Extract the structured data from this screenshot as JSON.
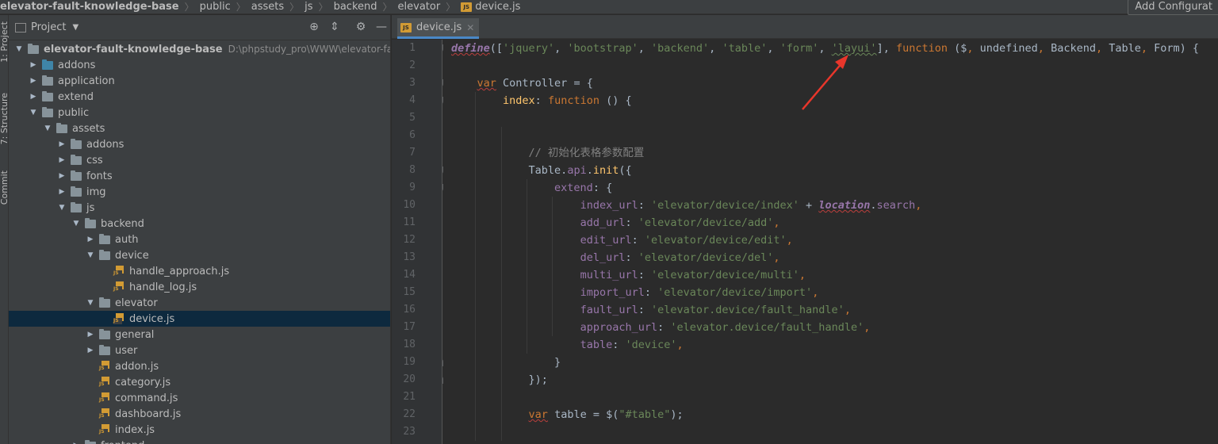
{
  "breadcrumbs": [
    "elevator-fault-knowledge-base",
    "public",
    "assets",
    "js",
    "backend",
    "elevator",
    "device.js"
  ],
  "toolbar": {
    "add_config": "Add Configurat"
  },
  "tool_windows": [
    "1: Project",
    "7: Structure",
    "Commit"
  ],
  "project_panel": {
    "title": "Project",
    "locate_icon": "crosshair-icon",
    "collapse_icon": "collapse-icon",
    "settings_icon": "gear-icon",
    "hide_icon": "minimize-icon"
  },
  "tree": [
    {
      "label": "elevator-fault-knowledge-base",
      "path": "D:\\phpstudy_pro\\WWW\\elevator-fault-knowledge-base",
      "depth": 0,
      "type": "folder",
      "expanded": true,
      "bold": true
    },
    {
      "label": "addons",
      "depth": 1,
      "type": "module",
      "expanded": false
    },
    {
      "label": "application",
      "depth": 1,
      "type": "folder",
      "expanded": false
    },
    {
      "label": "extend",
      "depth": 1,
      "type": "folder",
      "expanded": false
    },
    {
      "label": "public",
      "depth": 1,
      "type": "folder",
      "expanded": true
    },
    {
      "label": "assets",
      "depth": 2,
      "type": "folder",
      "expanded": true
    },
    {
      "label": "addons",
      "depth": 3,
      "type": "folder",
      "expanded": false
    },
    {
      "label": "css",
      "depth": 3,
      "type": "folder",
      "expanded": false
    },
    {
      "label": "fonts",
      "depth": 3,
      "type": "folder",
      "expanded": false
    },
    {
      "label": "img",
      "depth": 3,
      "type": "folder",
      "expanded": false
    },
    {
      "label": "js",
      "depth": 3,
      "type": "folder",
      "expanded": true
    },
    {
      "label": "backend",
      "depth": 4,
      "type": "folder",
      "expanded": true
    },
    {
      "label": "auth",
      "depth": 5,
      "type": "folder",
      "expanded": false
    },
    {
      "label": "device",
      "depth": 5,
      "type": "folder",
      "expanded": true
    },
    {
      "label": "handle_approach.js",
      "depth": 6,
      "type": "js"
    },
    {
      "label": "handle_log.js",
      "depth": 6,
      "type": "js"
    },
    {
      "label": "elevator",
      "depth": 5,
      "type": "folder",
      "expanded": true
    },
    {
      "label": "device.js",
      "depth": 6,
      "type": "js",
      "selected": true
    },
    {
      "label": "general",
      "depth": 5,
      "type": "folder",
      "expanded": false
    },
    {
      "label": "user",
      "depth": 5,
      "type": "folder",
      "expanded": false
    },
    {
      "label": "addon.js",
      "depth": 5,
      "type": "js"
    },
    {
      "label": "category.js",
      "depth": 5,
      "type": "js"
    },
    {
      "label": "command.js",
      "depth": 5,
      "type": "js"
    },
    {
      "label": "dashboard.js",
      "depth": 5,
      "type": "js"
    },
    {
      "label": "index.js",
      "depth": 5,
      "type": "js"
    },
    {
      "label": "frontend",
      "depth": 4,
      "type": "folder",
      "expanded": false
    }
  ],
  "editor": {
    "tab_label": "device.js",
    "close_icon": "close-icon",
    "line_numbers": [
      "1",
      "2",
      "3",
      "4",
      "5",
      "6",
      "7",
      "8",
      "9",
      "10",
      "11",
      "12",
      "13",
      "14",
      "15",
      "16",
      "17",
      "18",
      "19",
      "20",
      "21",
      "22",
      "23"
    ],
    "lines": [
      [
        [
          "def",
          "define"
        ],
        [
          "p",
          "(["
        ],
        [
          "str",
          "'jquery'"
        ],
        [
          "p",
          ", "
        ],
        [
          "str",
          "'bootstrap'"
        ],
        [
          "p",
          ", "
        ],
        [
          "str",
          "'backend'"
        ],
        [
          "p",
          ", "
        ],
        [
          "str",
          "'table'"
        ],
        [
          "p",
          ", "
        ],
        [
          "str",
          "'form'"
        ],
        [
          "p",
          ", "
        ],
        [
          "strg",
          "'layui'"
        ],
        [
          "p",
          "], "
        ],
        [
          "kw",
          "function"
        ],
        [
          "p",
          " ($"
        ],
        [
          "kw",
          ","
        ],
        [
          "p",
          " undefined"
        ],
        [
          "kw",
          ","
        ],
        [
          "p",
          " Backend"
        ],
        [
          "kw",
          ","
        ],
        [
          "p",
          " Table"
        ],
        [
          "kw",
          ","
        ],
        [
          "p",
          " Form) {"
        ]
      ],
      [],
      [
        [
          "p",
          "    "
        ],
        [
          "kww",
          "var"
        ],
        [
          "p",
          " Controller = {"
        ]
      ],
      [
        [
          "p",
          "        "
        ],
        [
          "fn",
          "index"
        ],
        [
          "p",
          ": "
        ],
        [
          "kw",
          "function"
        ],
        [
          "p",
          " () {"
        ]
      ],
      [],
      [],
      [
        [
          "p",
          "            "
        ],
        [
          "cmt",
          "// 初始化表格参数配置"
        ]
      ],
      [
        [
          "p",
          "            Table."
        ],
        [
          "prop",
          "api"
        ],
        [
          "p",
          "."
        ],
        [
          "fn",
          "init"
        ],
        [
          "p",
          "({"
        ]
      ],
      [
        [
          "p",
          "                "
        ],
        [
          "prop",
          "extend"
        ],
        [
          "p",
          ": {"
        ]
      ],
      [
        [
          "p",
          "                    "
        ],
        [
          "prop",
          "index_url"
        ],
        [
          "p",
          ": "
        ],
        [
          "str",
          "'elevator/device/index'"
        ],
        [
          "p",
          " + "
        ],
        [
          "glob",
          "location"
        ],
        [
          "p",
          "."
        ],
        [
          "prop",
          "search"
        ],
        [
          "kw",
          ","
        ]
      ],
      [
        [
          "p",
          "                    "
        ],
        [
          "prop",
          "add_url"
        ],
        [
          "p",
          ": "
        ],
        [
          "str",
          "'elevator/device/add'"
        ],
        [
          "kw",
          ","
        ]
      ],
      [
        [
          "p",
          "                    "
        ],
        [
          "prop",
          "edit_url"
        ],
        [
          "p",
          ": "
        ],
        [
          "str",
          "'elevator/device/edit'"
        ],
        [
          "kw",
          ","
        ]
      ],
      [
        [
          "p",
          "                    "
        ],
        [
          "prop",
          "del_url"
        ],
        [
          "p",
          ": "
        ],
        [
          "str",
          "'elevator/device/del'"
        ],
        [
          "kw",
          ","
        ]
      ],
      [
        [
          "p",
          "                    "
        ],
        [
          "prop",
          "multi_url"
        ],
        [
          "p",
          ": "
        ],
        [
          "str",
          "'elevator/device/multi'"
        ],
        [
          "kw",
          ","
        ]
      ],
      [
        [
          "p",
          "                    "
        ],
        [
          "prop",
          "import_url"
        ],
        [
          "p",
          ": "
        ],
        [
          "str",
          "'elevator/device/import'"
        ],
        [
          "kw",
          ","
        ]
      ],
      [
        [
          "p",
          "                    "
        ],
        [
          "prop",
          "fault_url"
        ],
        [
          "p",
          ": "
        ],
        [
          "str",
          "'elevator.device/fault_handle'"
        ],
        [
          "kw",
          ","
        ]
      ],
      [
        [
          "p",
          "                    "
        ],
        [
          "prop",
          "approach_url"
        ],
        [
          "p",
          ": "
        ],
        [
          "str",
          "'elevator.device/fault_handle'"
        ],
        [
          "kw",
          ","
        ]
      ],
      [
        [
          "p",
          "                    "
        ],
        [
          "prop",
          "table"
        ],
        [
          "p",
          ": "
        ],
        [
          "str",
          "'device'"
        ],
        [
          "kw",
          ","
        ]
      ],
      [
        [
          "p",
          "                }"
        ]
      ],
      [
        [
          "p",
          "            });"
        ]
      ],
      [],
      [
        [
          "p",
          "            "
        ],
        [
          "kww",
          "var"
        ],
        [
          "p",
          " table = $("
        ],
        [
          "str",
          "\"#table\""
        ],
        [
          "p",
          ");"
        ]
      ],
      []
    ]
  },
  "colors": {
    "background": "#2b2b2b",
    "panel": "#3c3f41",
    "selection": "#0d293e",
    "keyword": "#cc7832",
    "string": "#6a8759",
    "property": "#9876aa",
    "function": "#ffc66d",
    "comment": "#808080",
    "annotation_arrow": "#e8362b"
  }
}
